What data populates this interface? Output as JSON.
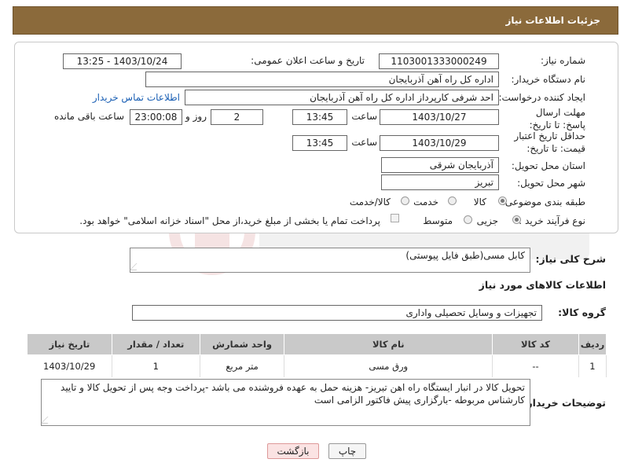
{
  "header": {
    "title": "جزئیات اطلاعات نیاز"
  },
  "form": {
    "need_number": {
      "label": "شماره نیاز:",
      "value": "1103001333000249"
    },
    "announce_datetime": {
      "label": "تاریخ و ساعت اعلان عمومی:",
      "value": "1403/10/24 - 13:25"
    },
    "buyer_org": {
      "label": "نام دستگاه خریدار:",
      "value": "اداره کل راه آهن آذربایجان"
    },
    "requester": {
      "label": "ایجاد کننده درخواست:",
      "value": "احد شرفی کارپرداز اداره کل راه آهن آذربایجان",
      "contact_link": "اطلاعات تماس خریدار"
    },
    "reply_deadline": {
      "label": "مهلت ارسال پاسخ: تا تاریخ:",
      "date": "1403/10/27",
      "time_label": "ساعت",
      "time": "13:45",
      "days": "2",
      "days_label": "روز و",
      "remaining": "23:00:08",
      "remaining_label": "ساعت باقی مانده"
    },
    "price_validity": {
      "label": "حداقل تاریخ اعتبار قیمت: تا تاریخ:",
      "date": "1403/10/29",
      "time_label": "ساعت",
      "time": "13:45"
    },
    "delivery_province": {
      "label": "استان محل تحویل:",
      "value": "آذربایجان شرقی"
    },
    "delivery_city": {
      "label": "شهر محل تحویل:",
      "value": "تبریز"
    },
    "category": {
      "label": "طبقه بندی موضوعی:",
      "options": [
        "کالا",
        "خدمت",
        "کالا/خدمت"
      ],
      "selected": "کالا"
    },
    "purchase_type": {
      "label": "نوع فرآیند خرید :",
      "options": [
        "جزیی",
        "متوسط"
      ],
      "selected": "جزیی",
      "payment_note": "پرداخت تمام یا بخشی از مبلغ خرید،از محل \"اسناد خزانه اسلامی\" خواهد بود."
    }
  },
  "summary": {
    "label": "شرح کلی نیاز:",
    "value": "کابل مسی(طبق فایل پیوستی)"
  },
  "goods_info": {
    "title": "اطلاعات کالاهای مورد نیاز"
  },
  "goods_group": {
    "label": "گروه کالا:",
    "value": "تجهیزات و وسایل تحصیلی واداری"
  },
  "table": {
    "headers": [
      "ردیف",
      "کد کالا",
      "نام کالا",
      "واحد شمارش",
      "تعداد / مقدار",
      "تاریخ نیاز"
    ],
    "rows": [
      [
        "1",
        "--",
        "ورق مسی",
        "متر مربع",
        "1",
        "1403/10/29"
      ]
    ]
  },
  "buyer_notes": {
    "label": "توضیحات خریدار:",
    "value": "تحویل کالا در انبار ایستگاه راه اهن تبریز- هزینه حمل به عهده  فروشنده می باشد -پرداخت وجه پس از تحویل کالا و تایید کارشناس مربوطه -بارگزاری پیش فاکتور الزامی است"
  },
  "buttons": {
    "print": "چاپ",
    "back": "بازگشت"
  },
  "colors": {
    "header_bg": "#8b6a3b",
    "table_header_bg": "#c9c9c9",
    "link": "#1a5fb4"
  }
}
